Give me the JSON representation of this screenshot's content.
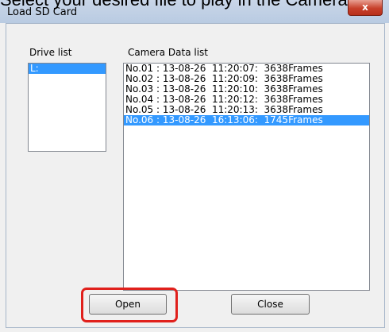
{
  "banner": {
    "text": "Select your desired file to play in the Camera"
  },
  "window": {
    "title": "Load SD Card",
    "close_glyph": "x"
  },
  "drive_list": {
    "label": "Drive list",
    "items": [
      {
        "label": "L:",
        "selected": true
      }
    ]
  },
  "camera_data_list": {
    "label": "Camera Data list",
    "items": [
      {
        "label": "No.01 : 13-08-26  11:20:07:  3638Frames",
        "selected": false
      },
      {
        "label": "No.02 : 13-08-26  11:20:09:  3638Frames",
        "selected": false
      },
      {
        "label": "No.03 : 13-08-26  11:20:10:  3638Frames",
        "selected": false
      },
      {
        "label": "No.04 : 13-08-26  11:20:12:  3638Frames",
        "selected": false
      },
      {
        "label": "No.05 : 13-08-26  11:20:13:  3638Frames",
        "selected": false
      },
      {
        "label": "No.06 : 13-08-26  16:13:06:  1745Frames",
        "selected": true
      }
    ]
  },
  "buttons": {
    "open_label": "Open",
    "close_label": "Close"
  },
  "colors": {
    "highlight": "#e0201c",
    "selection": "#3399ff"
  }
}
